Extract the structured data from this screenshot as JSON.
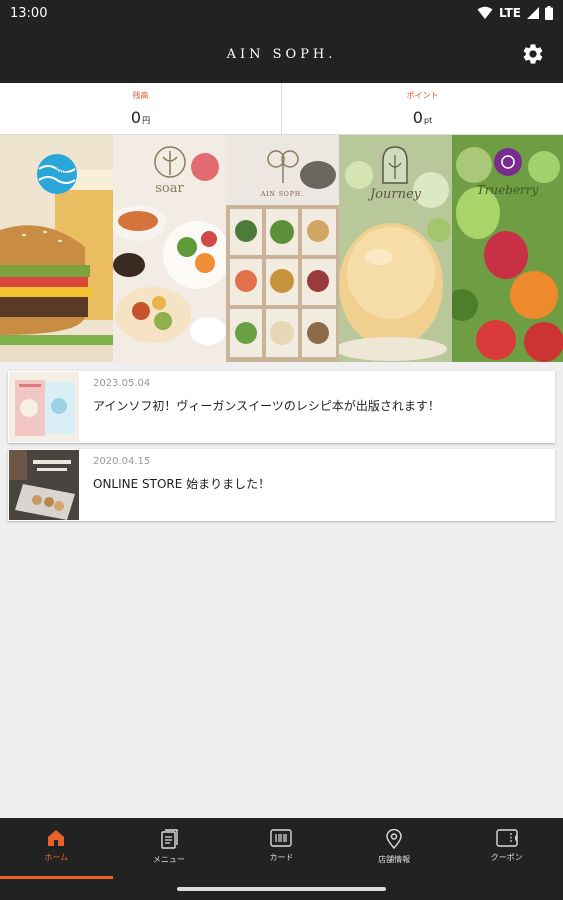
{
  "status_bar": {
    "time": "13:00",
    "network": "LTE"
  },
  "header": {
    "title": "AIN SOPH.",
    "settings_icon": "gear-icon"
  },
  "balance": {
    "balance_label": "残高",
    "balance_value": "0",
    "balance_unit": "円",
    "points_label": "ポイント",
    "points_value": "0",
    "points_unit": "pt"
  },
  "brands": [
    {
      "name": "ripple",
      "color": "#2aa7d8"
    },
    {
      "name": "soar",
      "color": "#8c7a5c"
    },
    {
      "name": "AIN SOPH.",
      "color": "#8c7a5c"
    },
    {
      "name": "Journey",
      "color": "#6e6354"
    },
    {
      "name": "Trueberry",
      "color": "#7a2c8f"
    }
  ],
  "news": [
    {
      "date": "2023.05.04",
      "title": "アインソフ初！ヴィーガンスイーツのレシピ本が出版されます！"
    },
    {
      "date": "2020.04.15",
      "title": "ONLINE STORE 始まりました！"
    }
  ],
  "nav": {
    "accent": "#e8622a",
    "items": [
      {
        "label": "ホーム",
        "icon": "home-icon",
        "active": true
      },
      {
        "label": "メニュー",
        "icon": "menu-book-icon"
      },
      {
        "label": "カード",
        "icon": "card-icon"
      },
      {
        "label": "店舗情報",
        "icon": "location-pin-icon"
      },
      {
        "label": "クーポン",
        "icon": "coupon-icon"
      }
    ]
  }
}
